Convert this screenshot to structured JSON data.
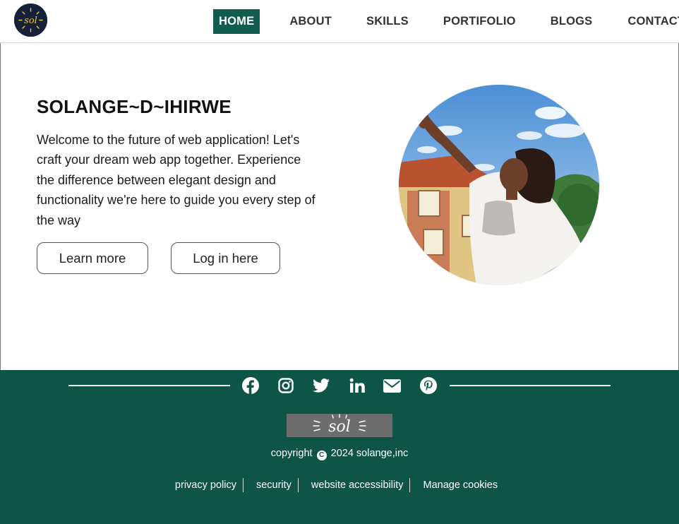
{
  "nav": {
    "items": [
      {
        "label": "HOME",
        "active": true
      },
      {
        "label": "ABOUT"
      },
      {
        "label": "SKILLS"
      },
      {
        "label": "PORTIFOLIO"
      },
      {
        "label": "BLOGS"
      },
      {
        "label": "CONTACT"
      }
    ]
  },
  "hero": {
    "title": "SOLANGE~D~IHIRWE",
    "description": "Welcome to the future of web application! Let's craft your dream web app together. Experience the difference between elegant design and functionality we're here to guide you every step of the way",
    "learn_more_label": "Learn more",
    "login_label": "Log in here"
  },
  "logo": {
    "text": "sol"
  },
  "footer": {
    "social_icons": [
      "facebook-icon",
      "instagram-icon",
      "twitter-icon",
      "linkedin-icon",
      "envelope-icon",
      "pinterest-icon"
    ],
    "badge_text": "sol",
    "copyright_prefix": "copyright",
    "copyright_suffix": "2024 solange,inc",
    "links": [
      "privacy policy",
      "security",
      "website accessibility",
      "Manage cookies"
    ]
  },
  "colors": {
    "brand_green": "#0e5548",
    "nav_active": "#105c4e",
    "logo_bg": "#15213a",
    "logo_accent": "#f2c230"
  }
}
